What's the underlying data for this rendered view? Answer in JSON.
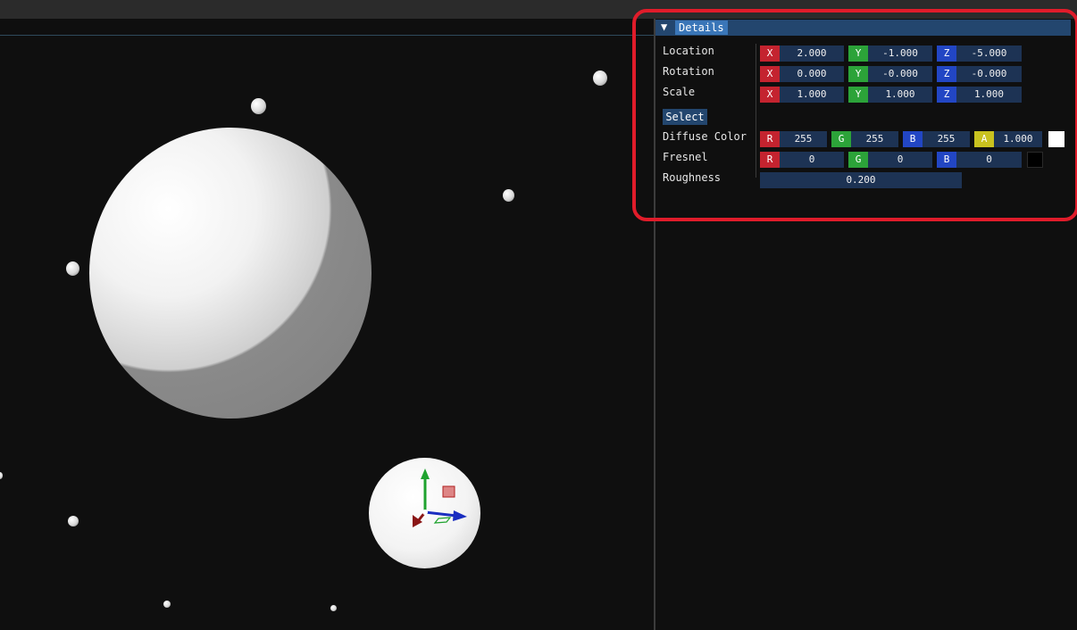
{
  "details_panel": {
    "title": "Details",
    "location": {
      "label": "Location",
      "x": "2.000",
      "y": "-1.000",
      "z": "-5.000"
    },
    "rotation": {
      "label": "Rotation",
      "x": "0.000",
      "y": "-0.000",
      "z": "-0.000"
    },
    "scale": {
      "label": "Scale",
      "x": "1.000",
      "y": "1.000",
      "z": "1.000"
    },
    "select_label": "Select",
    "diffuse_color": {
      "label": "Diffuse Color",
      "r": "255",
      "g": "255",
      "b": "255",
      "a": "1.000",
      "swatch": "#ffffff"
    },
    "fresnel": {
      "label": "Fresnel",
      "r": "0",
      "g": "0",
      "b": "0",
      "swatch": "#000000"
    },
    "roughness": {
      "label": "Roughness",
      "value": "0.200"
    }
  },
  "axis_tags": {
    "x": "X",
    "y": "Y",
    "z": "Z",
    "r": "R",
    "g": "G",
    "b": "B",
    "a": "A"
  },
  "colors": {
    "x_axis": "#c4232f",
    "y_axis": "#2ca339",
    "z_axis": "#2246c4",
    "alpha": "#c9c21f",
    "field_bg": "#1d3354",
    "header": "#23466e",
    "highlight": "#e01c2a"
  }
}
